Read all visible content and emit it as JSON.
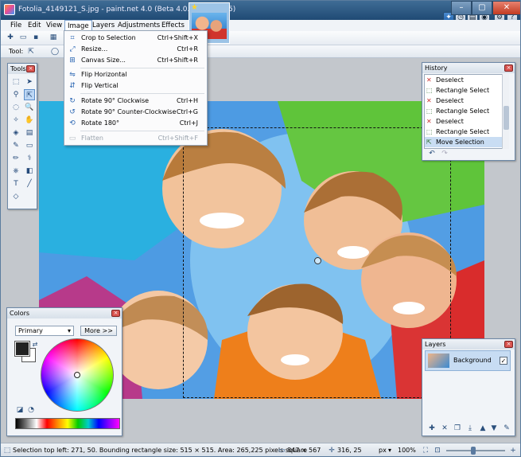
{
  "window": {
    "title": "Fotolia_4149121_S.jpg - paint.net 4.0 (Beta 4.0.5268.42065)"
  },
  "menubar": [
    "File",
    "Edit",
    "View",
    "Image",
    "Layers",
    "Adjustments",
    "Effects"
  ],
  "toolbar": {
    "tool_label": "Tool:"
  },
  "image_menu": {
    "items": [
      {
        "label": "Crop to Selection",
        "shortcut": "Ctrl+Shift+X",
        "icon": "crop-icon",
        "enabled": true
      },
      {
        "label": "Resize...",
        "shortcut": "Ctrl+R",
        "icon": "resize-icon",
        "enabled": true
      },
      {
        "label": "Canvas Size...",
        "shortcut": "Ctrl+Shift+R",
        "icon": "canvas-size-icon",
        "enabled": true
      },
      {
        "label": "Flip Horizontal",
        "shortcut": "",
        "icon": "flip-horizontal-icon",
        "enabled": true
      },
      {
        "label": "Flip Vertical",
        "shortcut": "",
        "icon": "flip-vertical-icon",
        "enabled": true
      },
      {
        "label": "Rotate 90° Clockwise",
        "shortcut": "Ctrl+H",
        "icon": "rotate-cw-icon",
        "enabled": true
      },
      {
        "label": "Rotate 90° Counter-Clockwise",
        "shortcut": "Ctrl+G",
        "icon": "rotate-ccw-icon",
        "enabled": true
      },
      {
        "label": "Rotate 180°",
        "shortcut": "Ctrl+J",
        "icon": "rotate-180-icon",
        "enabled": true
      },
      {
        "label": "Flatten",
        "shortcut": "Ctrl+Shift+F",
        "icon": "flatten-icon",
        "enabled": false
      }
    ]
  },
  "tools_panel": {
    "title": "Tools"
  },
  "history_panel": {
    "title": "History",
    "items": [
      {
        "label": "Deselect",
        "icon": "deselect-icon"
      },
      {
        "label": "Rectangle Select",
        "icon": "rectangle-select-icon"
      },
      {
        "label": "Deselect",
        "icon": "deselect-icon"
      },
      {
        "label": "Rectangle Select",
        "icon": "rectangle-select-icon"
      },
      {
        "label": "Deselect",
        "icon": "deselect-icon"
      },
      {
        "label": "Rectangle Select",
        "icon": "rectangle-select-icon"
      },
      {
        "label": "Move Selection",
        "icon": "move-selection-icon"
      }
    ]
  },
  "colors_panel": {
    "title": "Colors",
    "mode": "Primary",
    "more_button": "More >>",
    "primary_color": "#222222",
    "secondary_color": "#ffffff"
  },
  "layers_panel": {
    "title": "Layers",
    "layer_name": "Background",
    "visible_mark": "✓"
  },
  "status": {
    "selection_info": "Selection top left: 271, 50. Bounding rectangle size: 515 × 515. Area: 265,225 pixels square",
    "image_size": "847 × 567",
    "cursor_pos": "316, 25",
    "units": "px",
    "zoom": "100%"
  },
  "colors": {
    "titlebar": "#2b5a86",
    "accent": "#3a7bd5"
  }
}
